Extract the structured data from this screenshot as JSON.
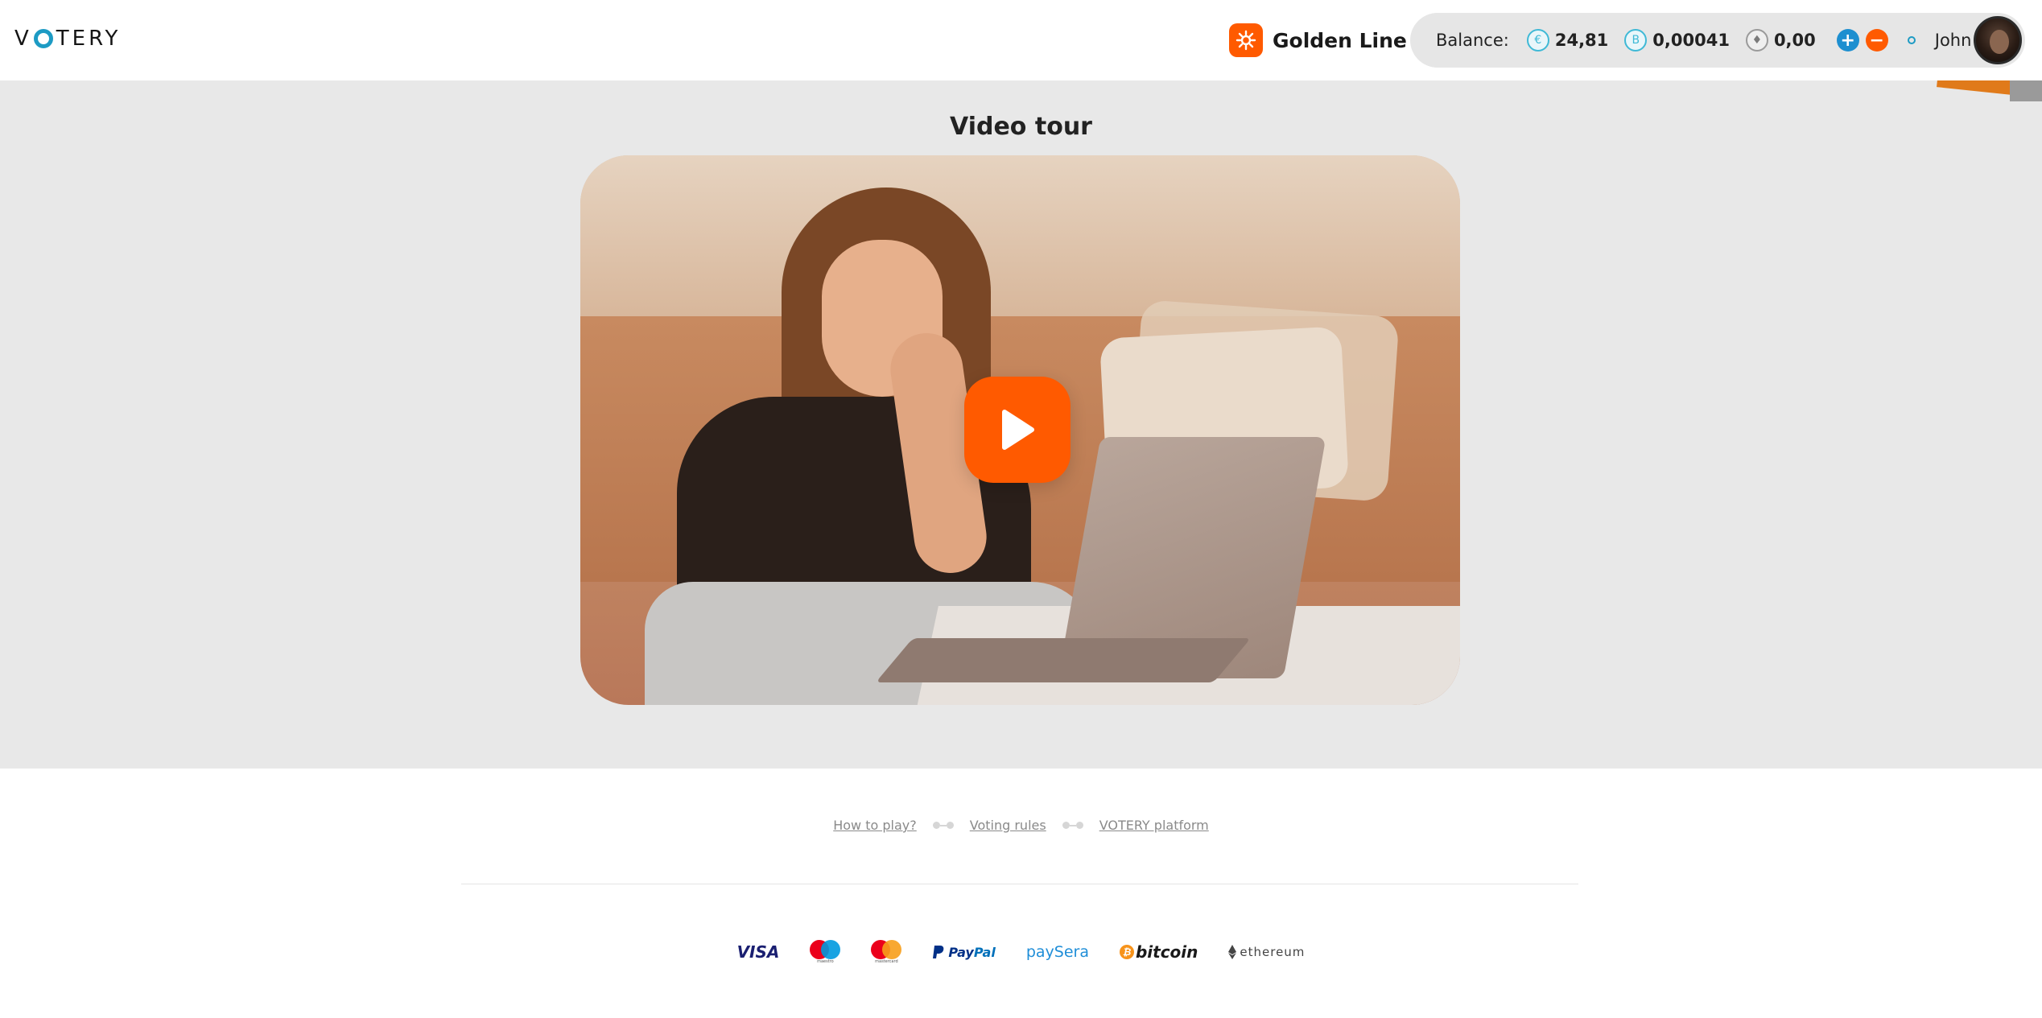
{
  "header": {
    "logo": {
      "before": "V",
      "after": "TERY"
    },
    "product": {
      "label": "Golden Line"
    },
    "balance": {
      "label": "Balance:",
      "eur": {
        "symbol": "€",
        "value": "24,81"
      },
      "btc": {
        "symbol": "B",
        "value": "0,00041"
      },
      "eth": {
        "symbol": "♦",
        "value": "0,00"
      },
      "plus_symbol": "+",
      "minus_symbol": "−"
    },
    "user": {
      "name": "John Doe"
    },
    "icons": [
      "golden-line-icon",
      "chevron-down-icon",
      "euro-icon",
      "bitcoin-icon",
      "ethereum-icon",
      "plus-icon",
      "minus-icon",
      "status-dot-icon"
    ]
  },
  "hero": {
    "title": "Video tour",
    "play_icon": "play-icon"
  },
  "footer": {
    "links": [
      "How to play?",
      "Voting rules",
      "VOTERY platform"
    ],
    "payments": {
      "visa": "VISA",
      "maestro": "maestro",
      "mastercard": "mastercard",
      "paypal_a": "Pay",
      "paypal_b": "Pal",
      "paysera": "paySera",
      "bitcoin_mark": "₿",
      "bitcoin": "bitcoin",
      "ethereum": "ethereum"
    }
  },
  "colors": {
    "accent": "#ff5a00",
    "brand_blue": "#1d9bc4",
    "hero_bg": "#e8e8e8"
  }
}
